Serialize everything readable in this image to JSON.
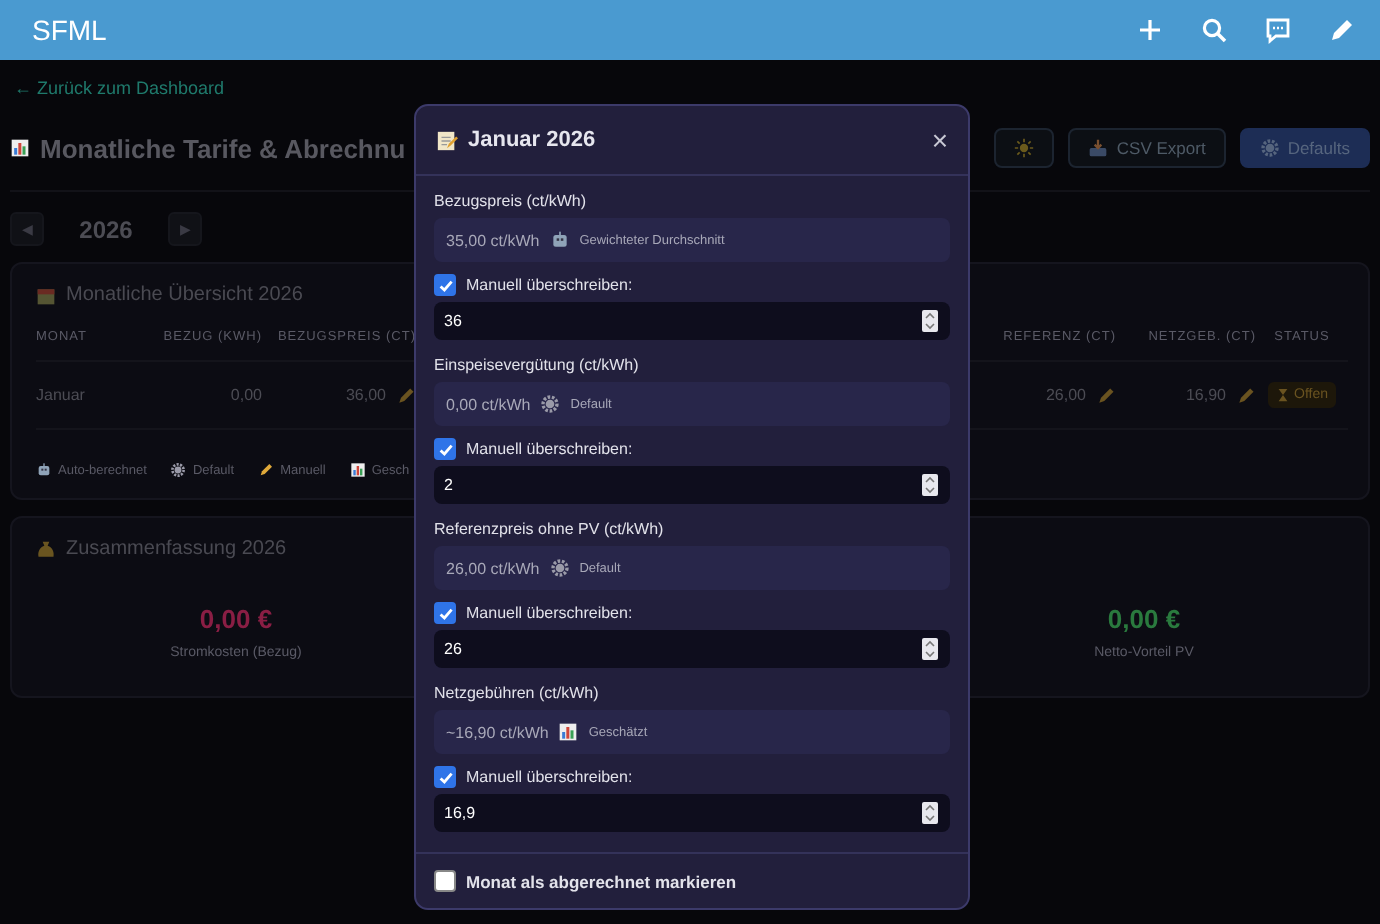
{
  "app_bar": {
    "title": "SFML"
  },
  "back_link": "← Zurück zum Dashboard",
  "page_title": "Monatliche Tarife & Abrechnu",
  "header_buttons": [
    {
      "kind": "theme"
    },
    {
      "kind": "export",
      "label": "CSV Export"
    },
    {
      "kind": "defaults",
      "label": "Defaults"
    }
  ],
  "year_nav": {
    "prev": "◀",
    "year": "2026",
    "next": "▶"
  },
  "overview": {
    "title": "Monatliche Übersicht 2026",
    "columns_left": [
      "MONAT",
      "BEZUG (KWH)",
      "BEZUGSPREIS (CT)"
    ],
    "columns_right": [
      "REFERENZ (CT)",
      "NETZGEB. (CT)",
      "STATUS"
    ],
    "row": {
      "left": [
        {
          "text": "Januar",
          "edited": false
        },
        {
          "text": "0,00",
          "edited": false
        },
        {
          "text": "36,00",
          "edited": true
        }
      ],
      "right": [
        {
          "text": "26,00",
          "edited": true
        },
        {
          "text": "16,90",
          "edited": true
        }
      ],
      "status": {
        "label": "Offen",
        "kind": "open"
      }
    },
    "legend": [
      {
        "kind": "auto",
        "label": "Auto-berechnet"
      },
      {
        "kind": "default",
        "label": "Default"
      },
      {
        "kind": "manual",
        "label": "Manuell"
      },
      {
        "kind": "estimated",
        "label": "Gesch"
      }
    ]
  },
  "summary": {
    "title": "Zusammenfassung 2026",
    "stats": [
      {
        "value": "0,00 €",
        "label": "Stromkosten (Bezug)",
        "kind": "cost"
      },
      {
        "value": "0,00 €",
        "label": "Netto-Vorteil PV",
        "kind": "gain"
      }
    ]
  },
  "dialog": {
    "title": "Januar 2026",
    "close": "×",
    "fields": [
      {
        "label": "Bezugspreis (ct/kWh)",
        "computed": "35,00 ct/kWh",
        "source": {
          "kind": "auto",
          "label": "Gewichteter Durchschnitt"
        },
        "override_label": "Manuell überschreiben:",
        "checked": true,
        "value": "36"
      },
      {
        "label": "Einspeisevergütung (ct/kWh)",
        "computed": "0,00 ct/kWh",
        "source": {
          "kind": "default",
          "label": "Default"
        },
        "override_label": "Manuell überschreiben:",
        "checked": true,
        "value": "2"
      },
      {
        "label": "Referenzpreis ohne PV (ct/kWh)",
        "computed": "26,00 ct/kWh",
        "source": {
          "kind": "default",
          "label": "Default"
        },
        "override_label": "Manuell überschreiben:",
        "checked": true,
        "value": "26"
      },
      {
        "label": "Netzgebühren (ct/kWh)",
        "computed": "~16,90 ct/kWh",
        "source": {
          "kind": "estimated",
          "label": "Geschätzt"
        },
        "override_label": "Manuell überschreiben:",
        "checked": true,
        "value": "16,9"
      }
    ],
    "settled": {
      "label": "Monat als abgerechnet markieren",
      "checked": false
    }
  }
}
